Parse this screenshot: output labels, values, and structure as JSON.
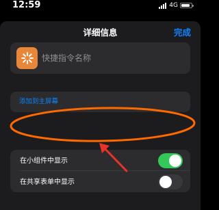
{
  "status_bar": {
    "time": "12:59",
    "network": "4G",
    "icons": [
      "signal-icon",
      "battery-icon"
    ]
  },
  "nav": {
    "title": "详细信息",
    "done_label": "完成"
  },
  "shortcut": {
    "icon": "shortcut-sparkle-icon",
    "icon_color": "#e8863a",
    "name_placeholder": "快捷指令名称"
  },
  "home_screen": {
    "label": "添加到主屏幕"
  },
  "toggles": [
    {
      "label": "在小组件中显示",
      "on": true
    },
    {
      "label": "在共享表单中显示",
      "on": false
    }
  ],
  "colors": {
    "accent": "#0a84ff",
    "switch_on": "#34c759",
    "annotation": "#ff6a00"
  }
}
